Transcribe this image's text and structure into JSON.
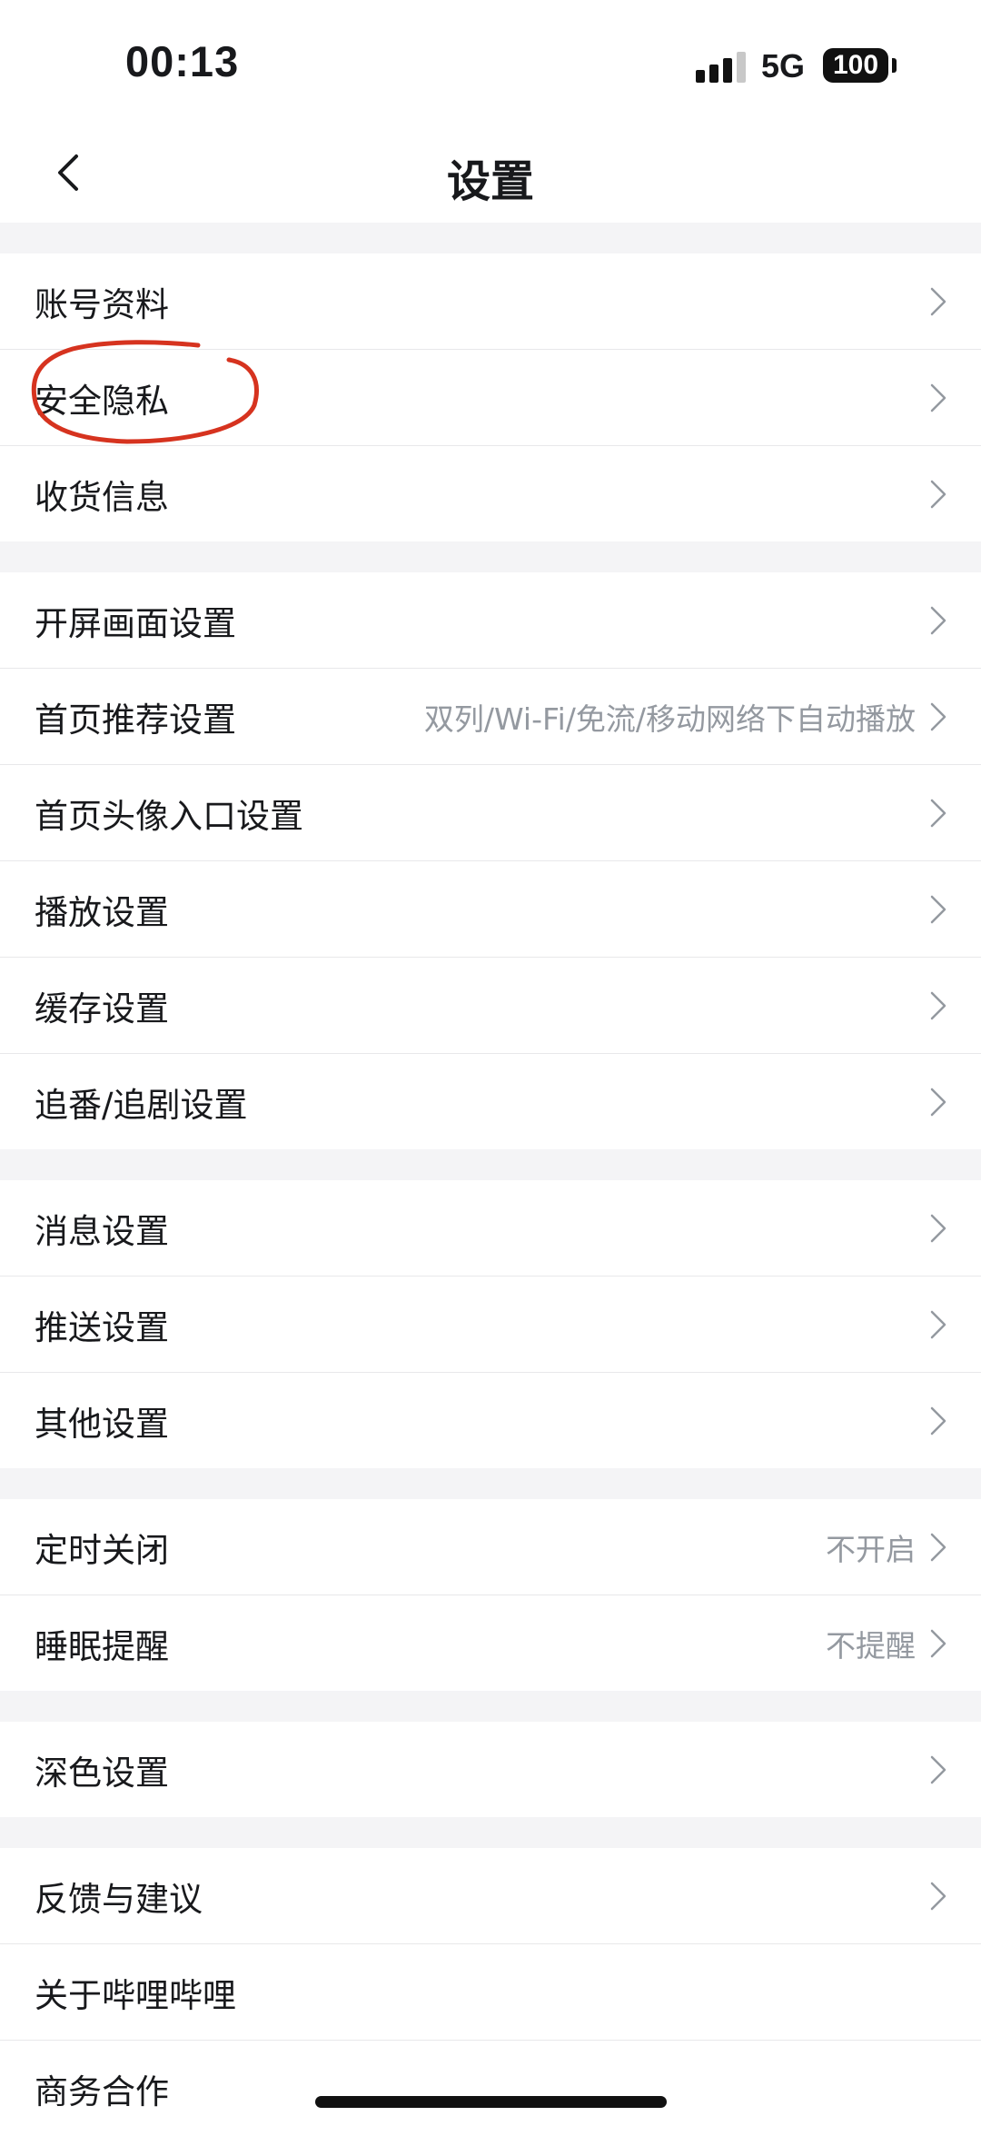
{
  "status_bar": {
    "time": "00:13",
    "network": "5G",
    "battery": "100"
  },
  "header": {
    "title": "设置",
    "back_icon": "chevron-left-icon"
  },
  "groups": [
    {
      "items": [
        {
          "label": "账号资料",
          "value": ""
        },
        {
          "label": "安全隐私",
          "value": ""
        },
        {
          "label": "收货信息",
          "value": ""
        }
      ]
    },
    {
      "items": [
        {
          "label": "开屏画面设置",
          "value": ""
        },
        {
          "label": "首页推荐设置",
          "value": "双列/Wi-Fi/免流/移动网络下自动播放"
        },
        {
          "label": "首页头像入口设置",
          "value": ""
        },
        {
          "label": "播放设置",
          "value": ""
        },
        {
          "label": "缓存设置",
          "value": ""
        },
        {
          "label": "追番/追剧设置",
          "value": ""
        }
      ]
    },
    {
      "items": [
        {
          "label": "消息设置",
          "value": ""
        },
        {
          "label": "推送设置",
          "value": ""
        },
        {
          "label": "其他设置",
          "value": ""
        }
      ]
    },
    {
      "items": [
        {
          "label": "定时关闭",
          "value": "不开启"
        },
        {
          "label": "睡眠提醒",
          "value": "不提醒"
        }
      ]
    },
    {
      "items": [
        {
          "label": "深色设置",
          "value": ""
        }
      ]
    },
    {
      "items": [
        {
          "label": "反馈与建议",
          "value": ""
        },
        {
          "label": "关于哔哩哔哩",
          "value": ""
        },
        {
          "label": "商务合作",
          "value": ""
        }
      ]
    }
  ],
  "colors": {
    "background": "#f4f4f6",
    "row_background": "#ffffff",
    "text": "#18191c",
    "secondary_text": "#9499a0",
    "annotation": "#d6331f"
  }
}
